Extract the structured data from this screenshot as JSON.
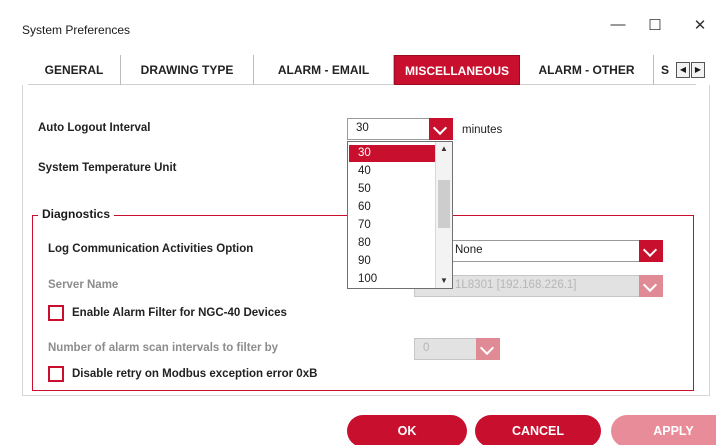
{
  "window": {
    "title": "System Preferences",
    "minimize_glyph": "—",
    "maximize_glyph": "☐",
    "close_glyph": "✕"
  },
  "tabs": [
    {
      "label": "GENERAL"
    },
    {
      "label": "DRAWING TYPE"
    },
    {
      "label": "ALARM - EMAIL"
    },
    {
      "label": "MISCELLANEOUS",
      "active": true
    },
    {
      "label": "ALARM - OTHER"
    },
    {
      "label": "S"
    }
  ],
  "tab_scroll": {
    "left": "◀",
    "right": "▶"
  },
  "misc": {
    "auto_logout_label": "Auto Logout Interval",
    "auto_logout_value": "30",
    "auto_logout_unit": "minutes",
    "temperature_unit_label": "System Temperature Unit"
  },
  "dropdown": {
    "options": [
      "30",
      "40",
      "50",
      "60",
      "70",
      "80",
      "90",
      "100"
    ],
    "selected": "30",
    "scroll_up": "▲",
    "scroll_down": "▼"
  },
  "diagnostics": {
    "title": "Diagnostics",
    "log_label": "Log Communication Activities Option",
    "log_value": "None",
    "server_label": "Server Name",
    "server_value": "1L8301 [192.168.226.1]",
    "alarm_filter_label": "Enable Alarm Filter for NGC-40 Devices",
    "alarm_scan_label": "Number of alarm scan intervals to filter by",
    "alarm_scan_value": "0",
    "disable_retry_label": "Disable retry on Modbus exception error 0xB"
  },
  "buttons": {
    "ok": "OK",
    "cancel": "CANCEL",
    "apply": "APPLY"
  },
  "colors": {
    "accent": "#c8102e",
    "accent_disabled": "#e98c99"
  }
}
